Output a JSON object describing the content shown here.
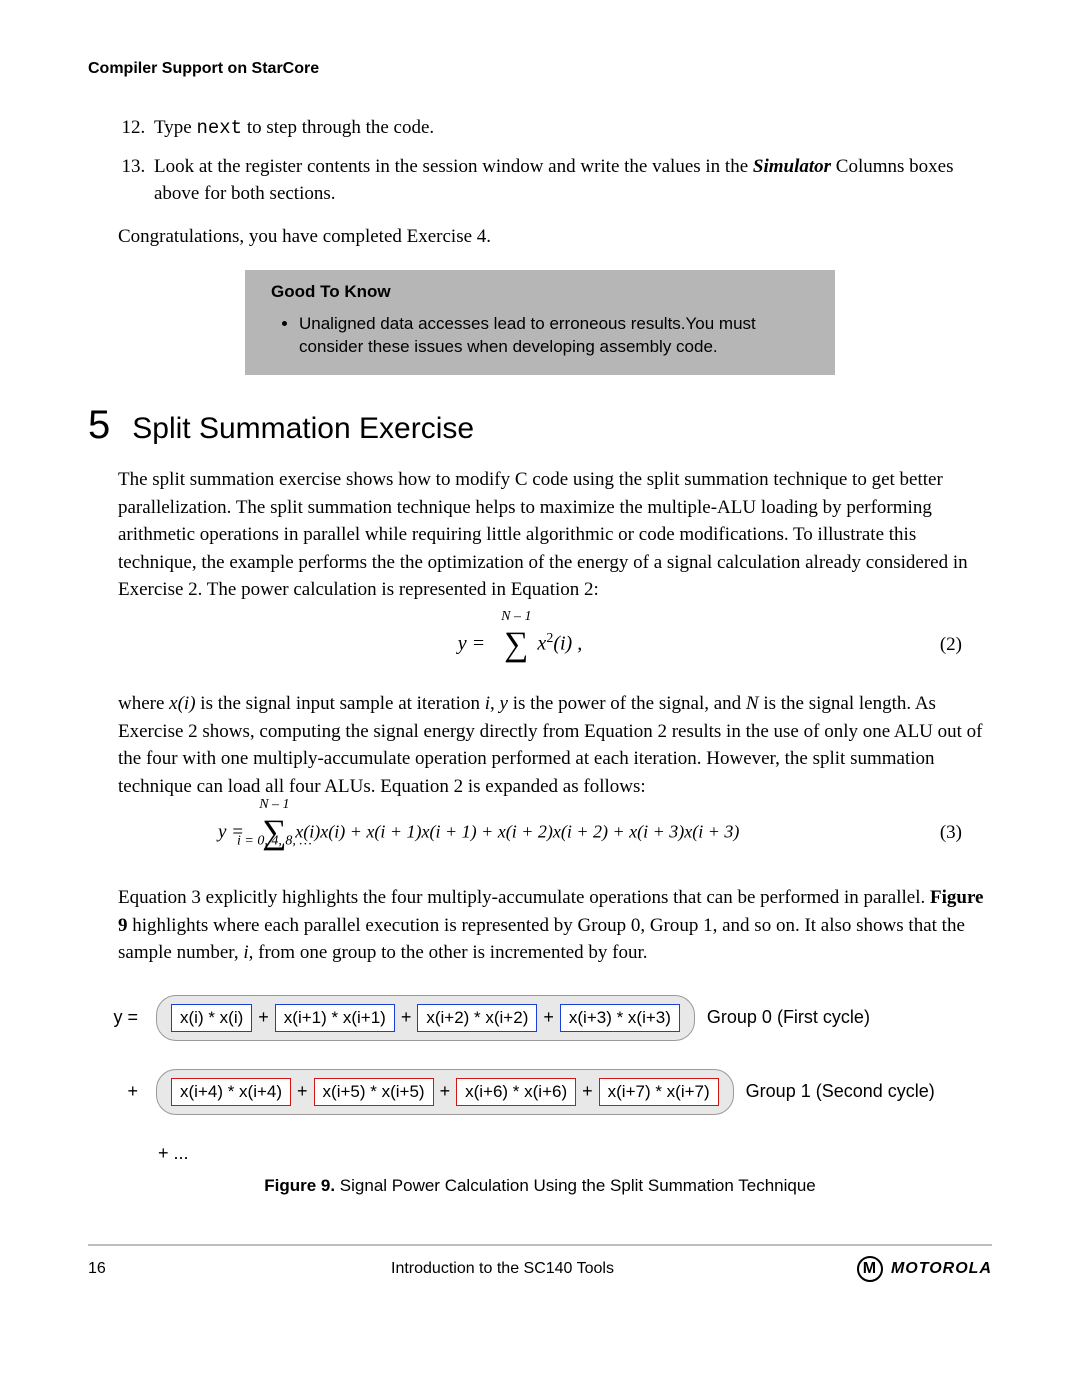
{
  "running_head": "Compiler Support on StarCore",
  "steps_start": 12,
  "steps": {
    "s12a": "Type ",
    "s12code": "next",
    "s12b": " to step through the code.",
    "s13a": "Look at the register contents in the session window and write the values in the ",
    "s13em": "Simulator",
    "s13b": " Columns boxes above for both sections."
  },
  "congrats": "Congratulations, you have completed Exercise 4.",
  "callout": {
    "title": "Good To Know",
    "item": "Unaligned data accesses lead to erroneous results.You must consider these issues when developing assembly code."
  },
  "section": {
    "num": "5",
    "title": "Split Summation Exercise"
  },
  "p1": "The split summation exercise shows how to modify C code using the split summation technique to get better parallelization. The split summation technique helps to maximize the multiple-ALU loading by performing arithmetic operations in parallel while requiring little algorithmic or code modifications. To illustrate this technique, the example performs the the optimization of the energy of a signal calculation already considered in Exercise 2. The power calculation is represented in Equation 2:",
  "eq2_num": "(2)",
  "eq2": {
    "left": "y  =",
    "upper": "N – 1",
    "term": "x",
    "exp": "2",
    "arg": "(i) ,"
  },
  "p2a": "where ",
  "p2b": " is the signal input sample at iteration ",
  "p2c": ", ",
  "p2d": " is the power of the signal, and ",
  "p2e": " is the signal length. As Exercise 2 shows, computing the signal energy directly from Equation 2 results in the use of only one ALU out of the four with one multiply-accumulate operation performed at each iteration. However, the split summation technique can load all four ALUs. Equation 2 is expanded as follows:",
  "p2_xi": "x(i)",
  "p2_i": "i",
  "p2_y": "y",
  "p2_N": "N",
  "eq3_num": "(3)",
  "eq3": {
    "left": "y  =",
    "upper": "N – 1",
    "lower": "i = 0, 4, 8, …",
    "body": "x(i)x(i) + x(i + 1)x(i + 1) + x(i + 2)x(i + 2) + x(i + 3)x(i + 3)"
  },
  "p3a": "Equation 3 explicitly highlights the four multiply-accumulate operations that can be performed in parallel. ",
  "p3b": "Figure 9",
  "p3c": " highlights where each parallel execution is represented by Group 0, Group 1, and so on. It also shows that the sample number, ",
  "p3d": ", from one group to the other is incremented by four.",
  "fig9": {
    "y": "y =",
    "plus": "+",
    "g0": {
      "terms": [
        "x(i) * x(i)",
        "x(i+1) * x(i+1)",
        "x(i+2) * x(i+2)",
        "x(i+3) * x(i+3)"
      ],
      "label": "Group 0 (First cycle)"
    },
    "g1": {
      "terms": [
        "x(i+4) * x(i+4)",
        "x(i+5) * x(i+5)",
        "x(i+6) * x(i+6)",
        "x(i+7) * x(i+7)"
      ],
      "label": "Group 1 (Second cycle)"
    },
    "dots": "+ ...",
    "caption_b": "Figure 9.",
    "caption": "   Signal Power Calculation Using the Split Summation Technique"
  },
  "footer": {
    "page": "16",
    "title": "Introduction to the SC140 Tools",
    "brand_glyph": "M",
    "brand": "MOTOROLA"
  }
}
